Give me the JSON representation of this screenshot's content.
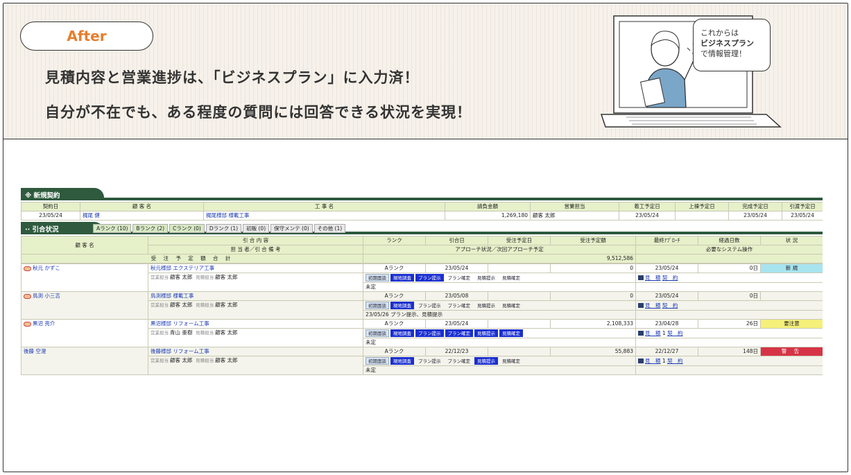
{
  "banner": {
    "badge": "After",
    "line1": "見積内容と営業進捗は、「ビジネスプラン」に入力済！",
    "line2": "自分が不在でも、ある程度の質問には回答できる状況を実現！",
    "bubble_l1": "これからは",
    "bubble_l2": "ビジネスプラン",
    "bubble_l3": "で情報管理！"
  },
  "new_contract": {
    "title": "新規契約",
    "headers": [
      "契約日",
      "顧 客 名",
      "工 事 名",
      "請負金額",
      "営業担当",
      "着工予定日",
      "上棟予定日",
      "完成予定日",
      "引渡予定日"
    ],
    "row": [
      "23/05/24",
      "梶尾 健",
      "梶尾様邸 様載工事",
      "1,269,180",
      "顧客 太郎",
      "23/05/24",
      "",
      "23/05/24",
      "23/05/24"
    ]
  },
  "inquiry": {
    "title": "引合状況",
    "tabs": [
      "Aランク (10)",
      "Bランク (2)",
      "Cランク (0)",
      "Dランク (1)",
      "初販 (0)",
      "保守メンテ (0)",
      "その他 (1)"
    ],
    "h1": [
      "顧 客 名",
      "引 合 内 容",
      "ランク",
      "引合日",
      "受注予定日",
      "受注予定額",
      "最終ｱﾌﾟﾛｰﾁ",
      "経過日数",
      "状 況"
    ],
    "h2": [
      "担 当 者／引 合 備 考",
      "アプローチ状況／次回アプローチ予定",
      "必要なシステム操作"
    ],
    "total_label": "受 注 予 定 額 合 計",
    "total_value": "9,512,586",
    "sales_tag": "営業担当",
    "est_tag": "見積担当",
    "action_mitsu": "見　積",
    "action_kei": "契　約",
    "rows": [
      {
        "customer": "秋元 かずこ",
        "project": "秋元様邸 エクステリア工事",
        "sales": "顧客 太郎",
        "est": "顧客 太郎",
        "rank": "Aランク",
        "date": "23/05/24",
        "due": "",
        "amount": "0",
        "last": "23/05/24",
        "days": "0日",
        "status": "新 規",
        "note": "未定",
        "steps": [
          "初期面談",
          "現地調査",
          "プラン提示",
          "プラン確定",
          "見積提示",
          "見積確定"
        ],
        "count": ""
      },
      {
        "customer": "鳥渕 小三吉",
        "project": "鳥渕様邸 様載工事",
        "sales": "顧客 太郎",
        "est": "顧客 太郎",
        "rank": "Aランク",
        "date": "23/05/08",
        "due": "",
        "amount": "0",
        "last": "23/05/24",
        "days": "0日",
        "status": "",
        "note": "23/05/26 プラン提示、見積提示",
        "steps": [
          "初期面談",
          "現地調査",
          "プラン提示",
          "プラン確定",
          "見積提示",
          "見積確定"
        ],
        "count": ""
      },
      {
        "customer": "黒沼 亮介",
        "project": "黒沼様邸 リフォーム工事",
        "sales": "青山 亜樹",
        "est": "顧客 太郎",
        "rank": "Aランク",
        "date": "23/05/24",
        "due": "",
        "amount": "2,108,333",
        "last": "23/04/28",
        "days": "26日",
        "status": "要注意",
        "note": "未定",
        "steps": [
          "初期面談",
          "現地調査",
          "プラン提示",
          "プラン確定",
          "見積提示",
          "見積確定"
        ],
        "count": "1"
      },
      {
        "customer": "後藤 空澄",
        "project": "後藤様邸 リフォーム工事",
        "sales": "顧客 太郎",
        "est": "顧客 太郎",
        "rank": "Aランク",
        "date": "22/12/23",
        "due": "",
        "amount": "55,883",
        "last": "22/12/27",
        "days": "148日",
        "status": "警 告",
        "note": "未定",
        "steps": [
          "初期面談",
          "現地調査",
          "プラン提示",
          "プラン確定",
          "見積提示",
          "見積確定"
        ],
        "count": "1"
      }
    ]
  }
}
